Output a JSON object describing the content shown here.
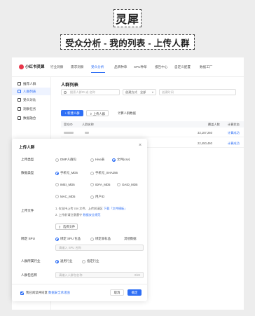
{
  "banner": {
    "logo": "灵犀",
    "subtitle": "受众分析 - 我的列表 - 上传人群"
  },
  "brand": {
    "name": "小红书灵犀"
  },
  "topnav": {
    "items": [
      "行业洞察",
      "需求洞察",
      "受众分析",
      "品牌种草",
      "SPU种草",
      "报告中心",
      "自定义配置",
      "数据工厂"
    ],
    "active": "受众分析"
  },
  "sidebar": {
    "items": [
      "推荐人群",
      "人群列表",
      "受众对比",
      "洞察任务",
      "数据融合"
    ],
    "active": "人群列表"
  },
  "main": {
    "title": "人群列表",
    "search_placeholder": "搜索人群ID 或 名称",
    "sort_label": "创建方式",
    "sort_value": "全部",
    "date_placeholder": "创建时间",
    "new_button": "+ 新建人群",
    "upload_tab": "上传人群",
    "calc_tab": "计算人群数据",
    "query_button": "查询"
  },
  "table": {
    "headers": [
      "受众ID",
      "人群名称",
      "覆盖人数",
      "计算状态"
    ],
    "rows": [
      {
        "count": "33,187,260",
        "status": "计算成功"
      },
      {
        "count": "22,450,460",
        "status": "计算成功"
      }
    ]
  },
  "modal": {
    "title": "上传人群",
    "close": "×",
    "upload_type": {
      "label": "上传类型",
      "options": [
        "DMP人群包",
        "Hive表",
        "文件(csv)"
      ],
      "selected": "文件(csv)"
    },
    "data_type": {
      "label": "数据类型",
      "options": [
        "手机号_MD5",
        "手机号_SHA256",
        "IMEI_MD5",
        "IDFA_MD5",
        "OAID_MD5",
        "MAC_MD5",
        "用户ID"
      ],
      "selected": "手机号_MD5"
    },
    "file": {
      "label": "上传文件",
      "hint1_prefix": "1. 仅支持上传 csv 文件，上传前请区",
      "hint1_link": "下载「文件模板」",
      "hint2_prefix": "2. 上传前请注意遵守",
      "hint2_link": "数据安全规范",
      "choose_button": "选择文件"
    },
    "spu": {
      "label": "绑定 SPU",
      "options": [
        "绑定 SPU 包品",
        "绑定非标品",
        "其他数据"
      ],
      "selected": "绑定 SPU 包品",
      "placeholder": "请输入 SPU 名称"
    },
    "industry": {
      "label": "人群所属行业",
      "options": [
        "通用行业",
        "指定行业"
      ],
      "selected": "通用行业"
    },
    "name": {
      "label": "人群包名称",
      "placeholder": "请输入人群包名称",
      "counter": "0/20"
    },
    "agree_prefix": "我已阅读并同意",
    "agree_link": "数据安全承诺函",
    "cancel": "取消",
    "confirm": "确定"
  },
  "colors": {
    "primary": "#2d6ef5",
    "brand": "#e8364a"
  }
}
